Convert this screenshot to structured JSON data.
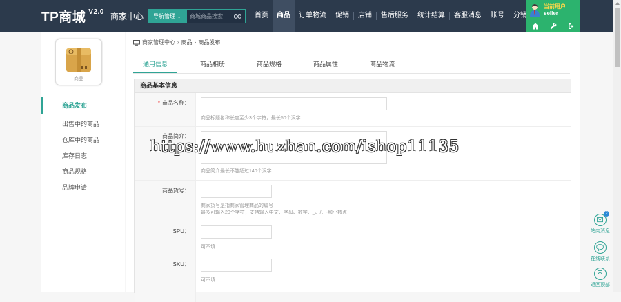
{
  "header": {
    "logo": "TP商城",
    "version": "V2.0",
    "center_title": "商家中心",
    "nav_mgmt": "导航管理",
    "search_placeholder": "商城商品搜索",
    "nav": [
      "首页",
      "商品",
      "订单物流",
      "促销",
      "店铺",
      "售后服务",
      "统计结算",
      "客服消息",
      "账号",
      "分销"
    ],
    "active_nav": "商品",
    "user_role": "当前用户",
    "user_name": "seller"
  },
  "sidebar": {
    "card_label": "商品",
    "menu": [
      "商品发布",
      "出售中的商品",
      "仓库中的商品",
      "库存日志",
      "商品规格",
      "品牌申请"
    ],
    "active": "商品发布"
  },
  "breadcrumb": [
    "商家管理中心",
    "商品",
    "商品发布"
  ],
  "tabs": [
    "通用信息",
    "商品相册",
    "商品规格",
    "商品属性",
    "商品物流"
  ],
  "active_tab": "通用信息",
  "form": {
    "section_title": "商品基本信息",
    "fields": [
      {
        "label": "商品名称：",
        "required": true,
        "value": "",
        "hint": "商品标题名称长度至少3个字符，最长50个汉字"
      },
      {
        "label": "商品简介：",
        "required": false,
        "value": "",
        "hint": "商品简介最长不能超过140个汉字"
      },
      {
        "label": "商品货号：",
        "required": false,
        "value": "",
        "hint": "商家货号是指商家管理商品的编号",
        "hint2": "最多可输入20个字符，支持输入中文、字母、数字、_、/、-和小数点"
      },
      {
        "label": "SPU：",
        "required": false,
        "value": "",
        "hint": "可不填"
      },
      {
        "label": "SKU：",
        "required": false,
        "value": "",
        "hint": "可不填"
      }
    ]
  },
  "watermark": "https://www.huzhan.com/ishop11135",
  "tools": [
    {
      "label": "站内消息",
      "badge": "2"
    },
    {
      "label": "在线联系"
    },
    {
      "label": "返回顶部"
    }
  ],
  "colors": {
    "header_bg": "#2c3a4c",
    "accent": "#2fa495",
    "user_bg": "#2cb36e"
  }
}
